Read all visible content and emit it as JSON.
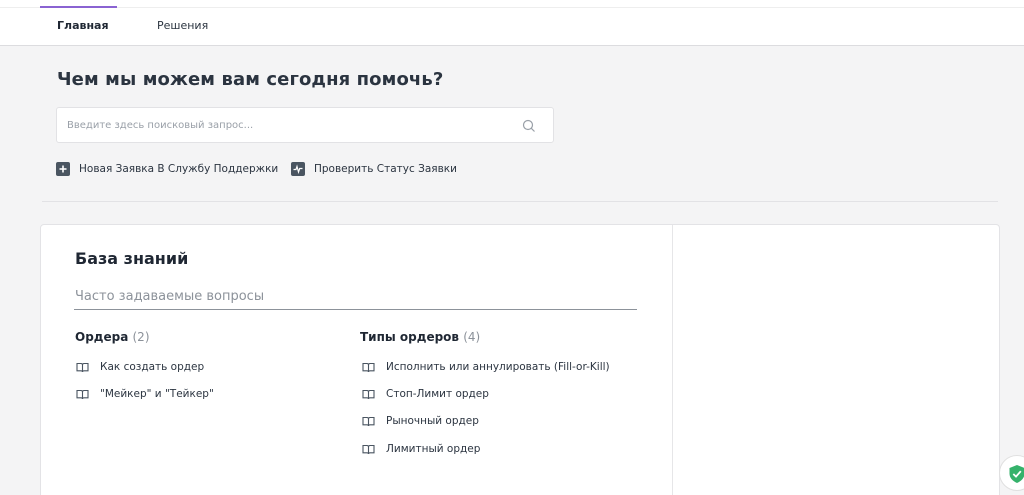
{
  "nav": {
    "tabs": [
      {
        "label": "Главная",
        "active": true
      },
      {
        "label": "Решения",
        "active": false
      }
    ]
  },
  "hero": {
    "title": "Чем мы можем вам сегодня помочь?",
    "search_placeholder": "Введите здесь поисковый запрос..."
  },
  "actions": [
    {
      "label": "Новая Заявка В Службу Поддержки",
      "icon": "plus-square-icon"
    },
    {
      "label": "Проверить Статус Заявки",
      "icon": "pulse-square-icon"
    }
  ],
  "knowledge_base": {
    "title": "База знаний",
    "section": "Часто задаваемые вопросы",
    "categories": [
      {
        "name": "Ордера",
        "count": "(2)",
        "articles": [
          "Как создать ордер",
          "\"Мейкер\" и \"Тейкер\""
        ]
      },
      {
        "name": "Типы ордеров",
        "count": "(4)",
        "articles": [
          "Исполнить или аннулировать (Fill-or-Kill)",
          "Стоп-Лимит ордер",
          "Рыночный ордер",
          "Лимитный ордер"
        ]
      }
    ]
  },
  "colors": {
    "accent": "#8a63d2",
    "background": "#f4f4f5",
    "text": "#2b3440",
    "muted": "#8c929a",
    "shield": "#35b26b"
  }
}
